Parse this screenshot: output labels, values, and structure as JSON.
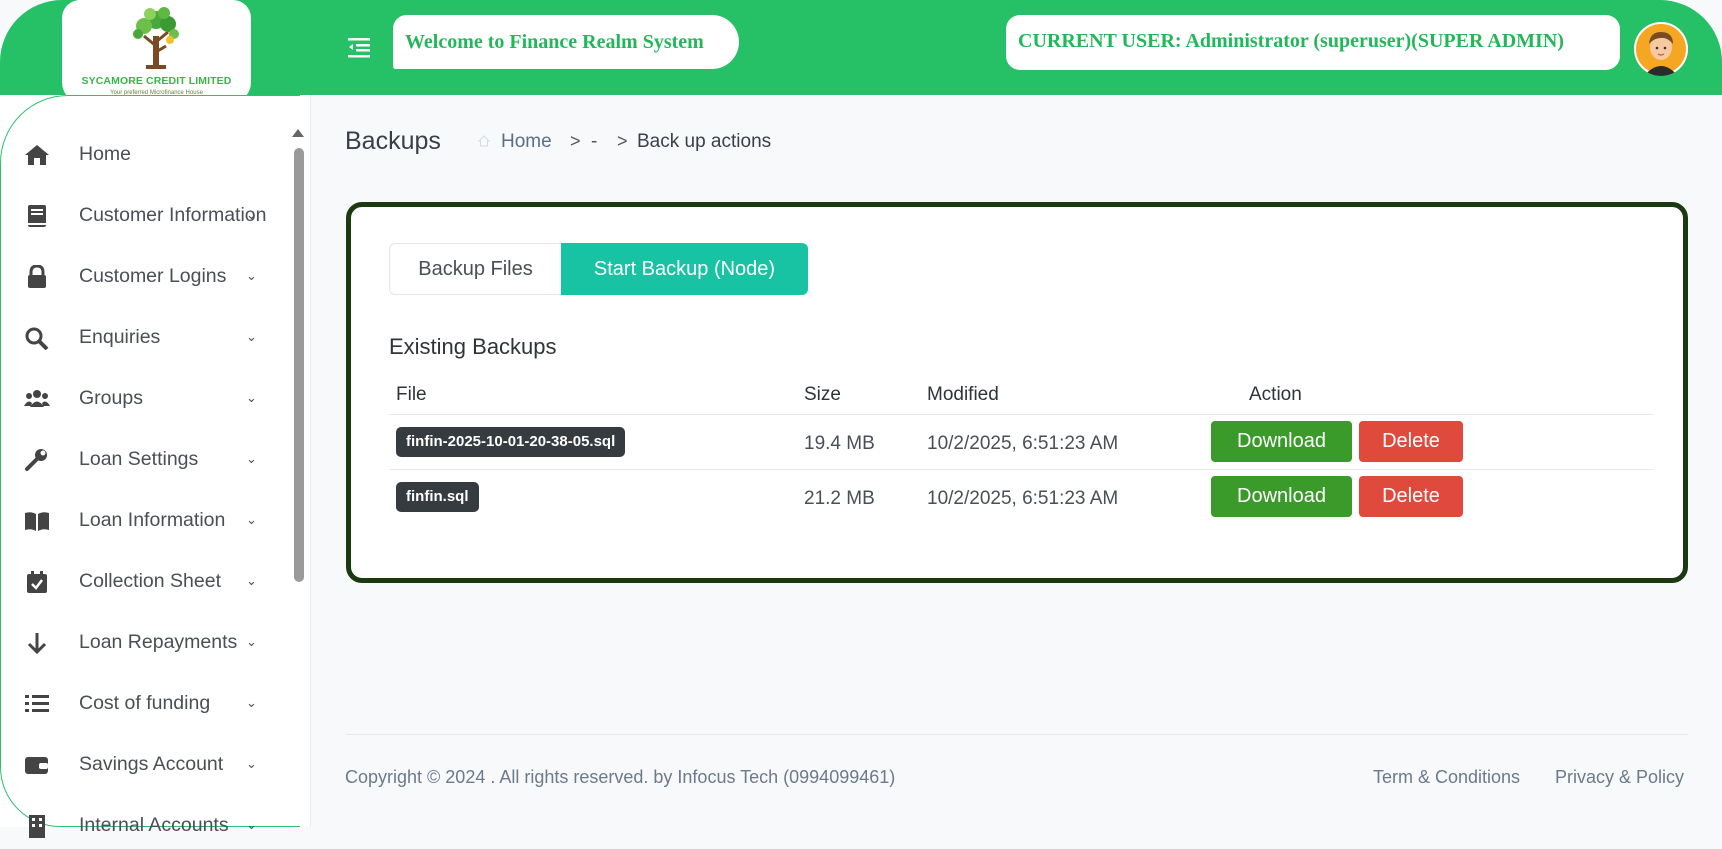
{
  "header": {
    "logo_name": "SYCAMORE CREDIT LIMITED",
    "logo_tagline": "Your preferred Microfinance House",
    "welcome": "Welcome to Finance Realm System",
    "current_user": "CURRENT USER: Administrator (superuser)(SUPER ADMIN)"
  },
  "sidebar": {
    "items": [
      {
        "label": "Home",
        "icon": "home-icon"
      },
      {
        "label": "Customer Information",
        "icon": "book-icon"
      },
      {
        "label": "Customer Logins",
        "icon": "lock-icon"
      },
      {
        "label": "Enquiries",
        "icon": "search-icon"
      },
      {
        "label": "Groups",
        "icon": "users-icon"
      },
      {
        "label": "Loan Settings",
        "icon": "wrench-icon"
      },
      {
        "label": "Loan Information",
        "icon": "open-book-icon"
      },
      {
        "label": "Collection Sheet",
        "icon": "calendar-check-icon"
      },
      {
        "label": "Loan Repayments",
        "icon": "arrow-down-icon"
      },
      {
        "label": "Cost of funding",
        "icon": "list-icon"
      },
      {
        "label": "Savings Account",
        "icon": "wallet-icon"
      },
      {
        "label": "Internal Accounts",
        "icon": "building-icon"
      }
    ]
  },
  "page": {
    "title": "Backups",
    "breadcrumb": {
      "home": "Home",
      "sep": ">",
      "middle": "-",
      "current": "Back up actions"
    }
  },
  "tabs": {
    "files": "Backup Files",
    "start": "Start Backup (Node)"
  },
  "backups": {
    "title": "Existing Backups",
    "headers": {
      "file": "File",
      "size": "Size",
      "modified": "Modified",
      "action": "Action"
    },
    "rows": [
      {
        "file": "finfin-2025-10-01-20-38-05.sql",
        "size": "19.4 MB",
        "modified": "10/2/2025, 6:51:23 AM",
        "download": "Download",
        "delete": "Delete"
      },
      {
        "file": "finfin.sql",
        "size": "21.2 MB",
        "modified": "10/2/2025, 6:51:23 AM",
        "download": "Download",
        "delete": "Delete"
      }
    ]
  },
  "footer": {
    "copyright": "Copyright © 2024 . All rights reserved. by Infocus Tech (0994099461)",
    "terms": "Term & Conditions",
    "privacy": "Privacy & Policy"
  },
  "colors": {
    "brand_green": "#26c066",
    "teal_tab": "#17c3a2",
    "download": "#3a9a2a",
    "delete": "#e04a3c",
    "card_border": "#1c3a12"
  }
}
